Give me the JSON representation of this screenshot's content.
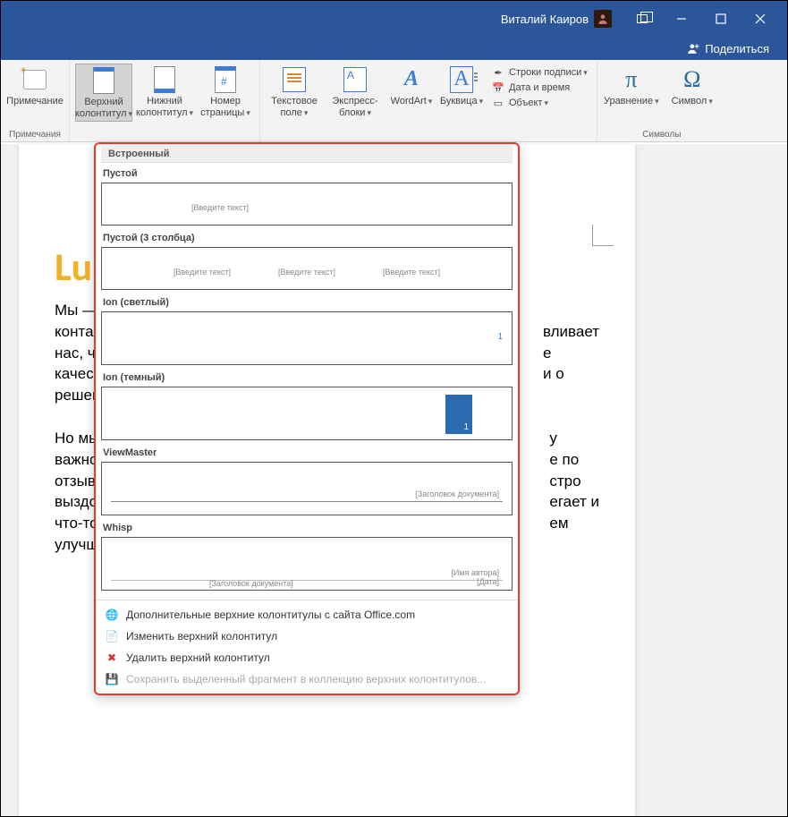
{
  "titlebar": {
    "username": "Виталий Каиров"
  },
  "sharebar": {
    "share": "Поделиться"
  },
  "ribbon": {
    "comments": {
      "new_comment": "Примечание",
      "group_label": "Примечания"
    },
    "header_footer": {
      "header": "Верхний колонтитул",
      "footer": "Нижний колонтитул",
      "page_number": "Номер страницы"
    },
    "text": {
      "textbox": "Текстовое поле",
      "quickparts": "Экспресс-блоки",
      "wordart": "WordArt",
      "dropcap": "Буквица"
    },
    "text_side": {
      "signature": "Строки подписи",
      "datetime": "Дата и время",
      "object": "Объект"
    },
    "symbols": {
      "equation": "Уравнение",
      "symbol": "Символ",
      "group_label": "Символы"
    }
  },
  "document": {
    "title": "Lum",
    "p1a": "Мы — груп",
    "p1b": "контакте c",
    "p1c": "нас, чтобы",
    "p1d": "качествен",
    "p1e": "решении р",
    "p1r1": "вливает",
    "p1r2": "е",
    "p1r3": "и о",
    "p2a": "Но мы не с",
    "p2b": "важно зна",
    "p2c": "отзывам ч",
    "p2d": "выздоравл",
    "p2e": "что-то нас",
    "p2f": "улучшатьс",
    "p2r1": "у",
    "p2r2": "е по",
    "p2r3": "стро",
    "p2r4": "егает и",
    "p2r5": "ем"
  },
  "gallery": {
    "section": "Встроенный",
    "items": [
      {
        "label": "Пустой",
        "type": "empty1",
        "ph1": "[Введите текст]"
      },
      {
        "label": "Пустой (3 столбца)",
        "type": "empty3",
        "ph1": "[Введите текст]",
        "ph2": "[Введите текст]",
        "ph3": "[Введите текст]"
      },
      {
        "label": "Ion (светлый)",
        "type": "ion_light",
        "num": "1"
      },
      {
        "label": "Ion (темный)",
        "type": "ion_dark",
        "num": "1"
      },
      {
        "label": "ViewMaster",
        "type": "viewmaster",
        "ph1": "[Заголовок документа]"
      },
      {
        "label": "Whisp",
        "type": "whisp",
        "ph1": "[Заголовок документа]",
        "ph2": "[Имя автора]",
        "ph3": "[Дата]"
      }
    ],
    "footer": {
      "more": "Дополнительные верхние колонтитулы с сайта Office.com",
      "edit": "Изменить верхний колонтитул",
      "remove": "Удалить верхний колонтитул",
      "save_selection": "Сохранить выделенный фрагмент в коллекцию верхних колонтитулов..."
    }
  }
}
